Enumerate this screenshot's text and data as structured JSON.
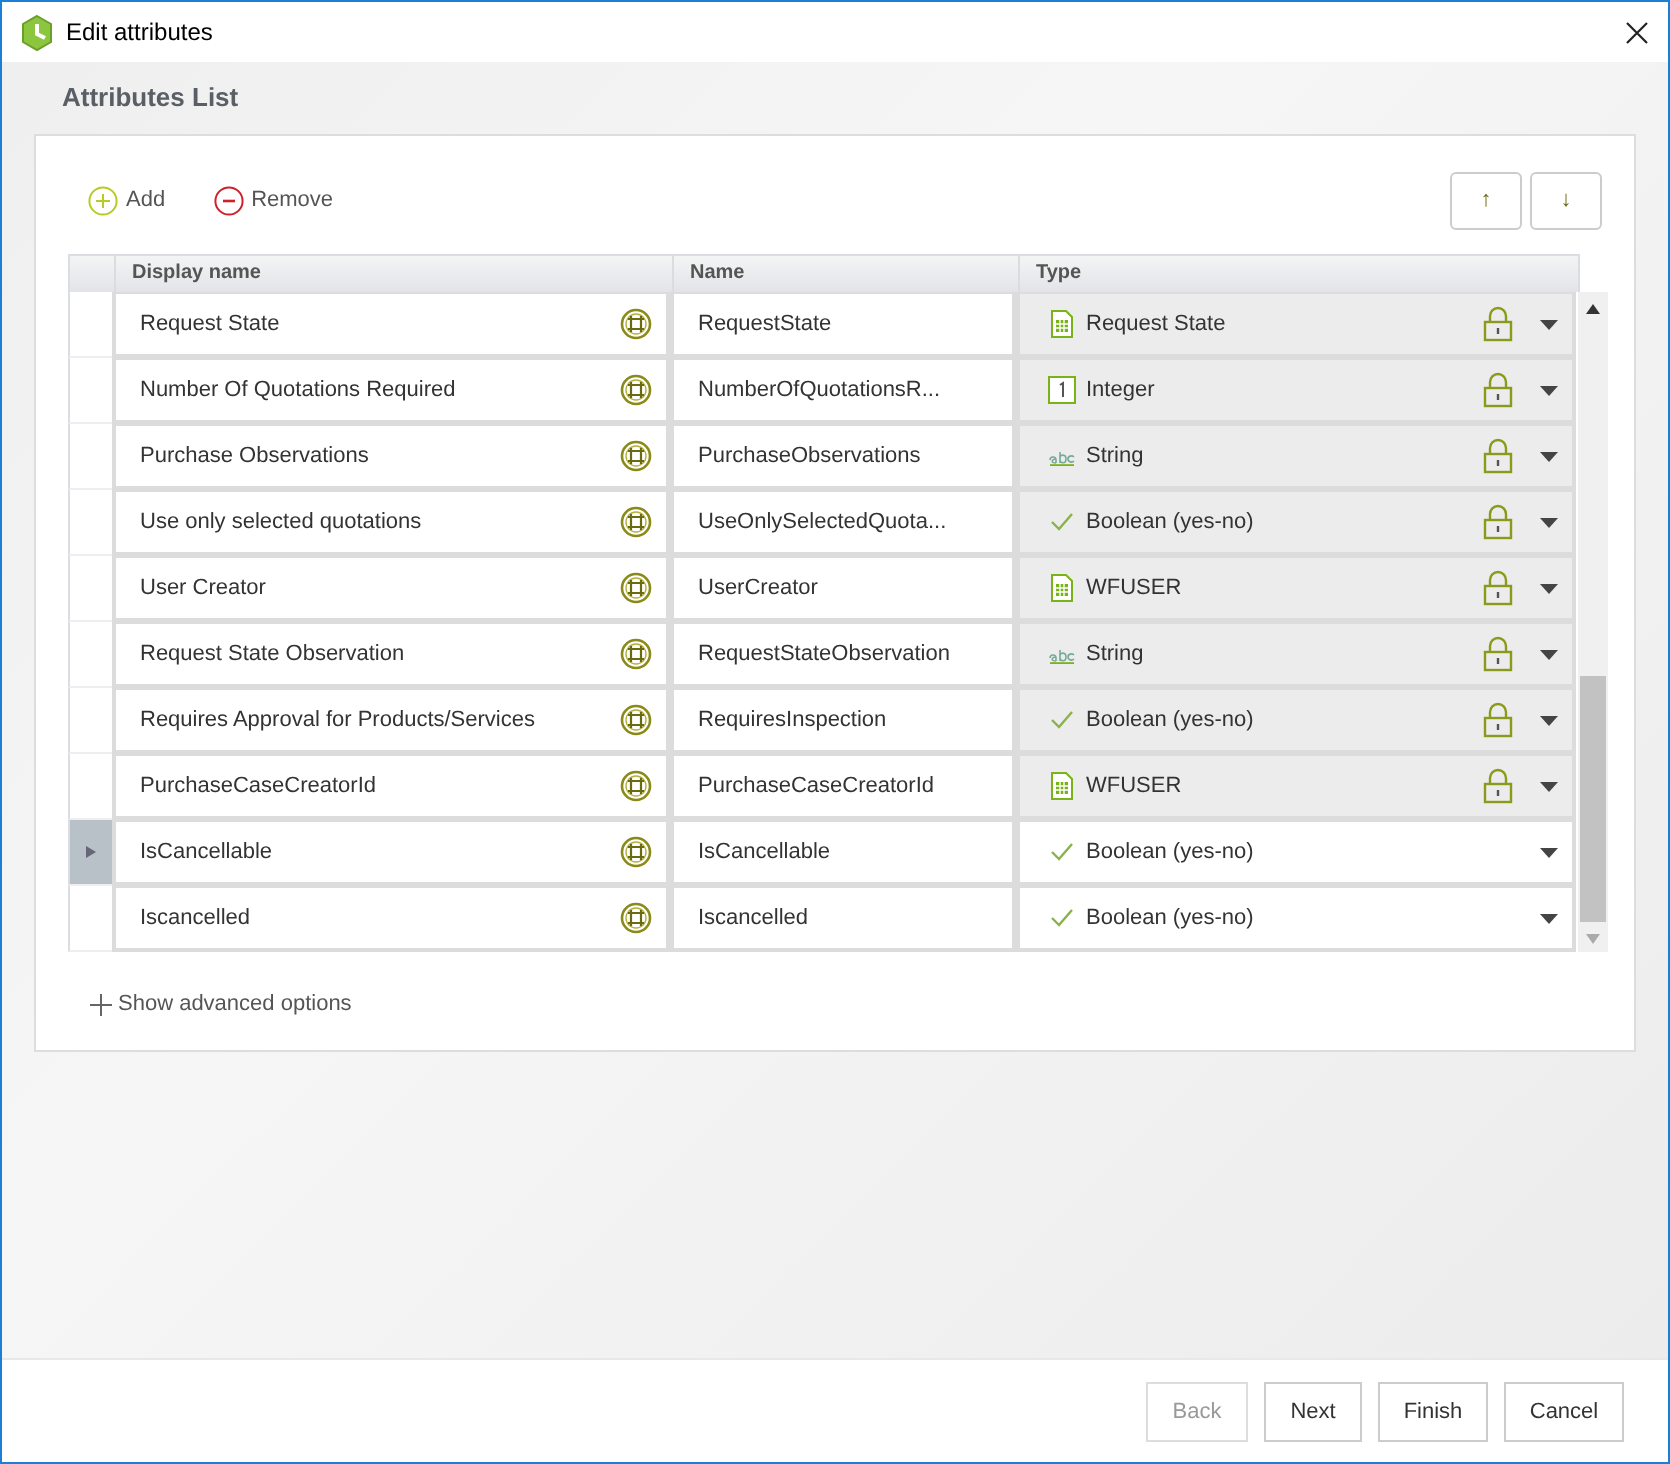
{
  "window": {
    "title": "Edit attributes"
  },
  "heading": "Attributes List",
  "toolbar": {
    "add": "Add",
    "remove": "Remove",
    "move_up": "↑",
    "move_down": "↓"
  },
  "table": {
    "columns": [
      "Display name",
      "Name",
      "Type"
    ],
    "rows": [
      {
        "display_name": "Request State",
        "name": "RequestState",
        "type": "Request State",
        "kind": "entity",
        "locked": true,
        "selected": false
      },
      {
        "display_name": "Number Of Quotations Required",
        "name": "NumberOfQuotationsR...",
        "type": "Integer",
        "kind": "integer",
        "locked": true,
        "selected": false
      },
      {
        "display_name": "Purchase Observations",
        "name": "PurchaseObservations",
        "type": "String",
        "kind": "string",
        "locked": true,
        "selected": false
      },
      {
        "display_name": "Use only selected quotations",
        "name": "UseOnlySelectedQuota...",
        "type": "Boolean (yes-no)",
        "kind": "boolean",
        "locked": true,
        "selected": false
      },
      {
        "display_name": "User Creator",
        "name": "UserCreator",
        "type": "WFUSER",
        "kind": "entity",
        "locked": true,
        "selected": false
      },
      {
        "display_name": "Request State Observation",
        "name": "RequestStateObservation",
        "type": "String",
        "kind": "string",
        "locked": true,
        "selected": false
      },
      {
        "display_name": "Requires Approval for Products/Services",
        "name": "RequiresInspection",
        "type": "Boolean (yes-no)",
        "kind": "boolean",
        "locked": true,
        "selected": false
      },
      {
        "display_name": "PurchaseCaseCreatorId",
        "name": "PurchaseCaseCreatorId",
        "type": "WFUSER",
        "kind": "entity",
        "locked": true,
        "selected": false
      },
      {
        "display_name": "IsCancellable",
        "name": "IsCancellable",
        "type": "Boolean (yes-no)",
        "kind": "boolean",
        "locked": false,
        "selected": true
      },
      {
        "display_name": "Iscancelled",
        "name": "Iscancelled",
        "type": "Boolean (yes-no)",
        "kind": "boolean",
        "locked": false,
        "selected": false
      }
    ]
  },
  "advanced": "Show advanced options",
  "buttons": [
    {
      "label": "Back",
      "disabled": true
    },
    {
      "label": "Next",
      "disabled": false
    },
    {
      "label": "Finish",
      "disabled": false
    },
    {
      "label": "Cancel",
      "disabled": false
    }
  ]
}
